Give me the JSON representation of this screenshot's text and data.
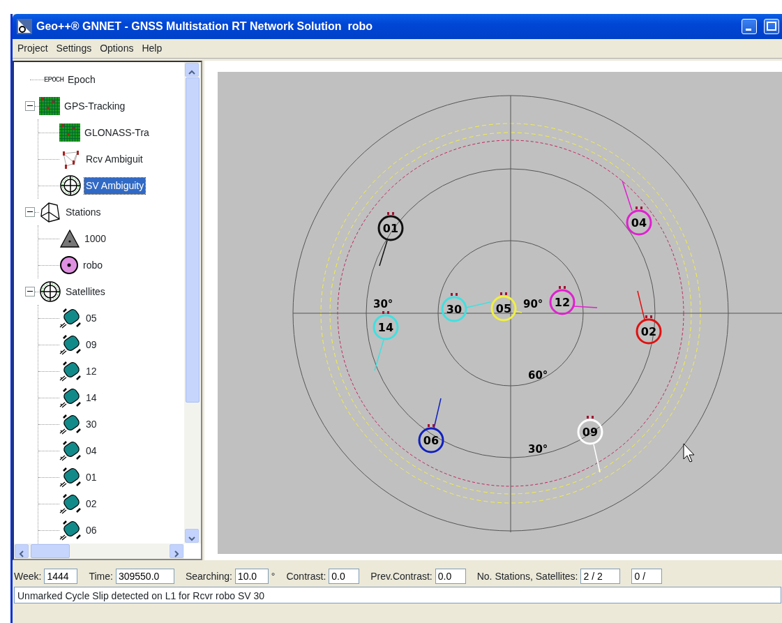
{
  "window": {
    "title": "Geo++® GNNET - GNSS Multistation RT Network Solution  robo"
  },
  "menu": [
    "Project",
    "Settings",
    "Options",
    "Help"
  ],
  "tree": [
    {
      "label": "Epoch",
      "kind": "epoch",
      "icon_text": "EPOCH",
      "selected": false
    },
    {
      "label": "GPS-Tracking",
      "kind": "grid",
      "selected": false,
      "expanded": true,
      "children": [
        {
          "label": "GLONASS-Tra",
          "kind": "grid",
          "selected": false
        },
        {
          "label": "Rcv Ambiguit",
          "kind": "network",
          "selected": false
        },
        {
          "label": "SV Ambiguity",
          "kind": "polar",
          "selected": true
        }
      ]
    },
    {
      "label": "Stations",
      "kind": "stations",
      "selected": false,
      "expanded": true,
      "children": [
        {
          "label": "1000",
          "kind": "triangle",
          "selected": false
        },
        {
          "label": "robo",
          "kind": "dot",
          "selected": false
        }
      ]
    },
    {
      "label": "Satellites",
      "kind": "polar",
      "selected": false,
      "expanded": true,
      "children": [
        {
          "label": "05",
          "kind": "satellite",
          "selected": false
        },
        {
          "label": "09",
          "kind": "satellite",
          "selected": false
        },
        {
          "label": "12",
          "kind": "satellite",
          "selected": false
        },
        {
          "label": "14",
          "kind": "satellite",
          "selected": false
        },
        {
          "label": "30",
          "kind": "satellite",
          "selected": false
        },
        {
          "label": "04",
          "kind": "satellite",
          "selected": false
        },
        {
          "label": "01",
          "kind": "satellite",
          "selected": false
        },
        {
          "label": "02",
          "kind": "satellite",
          "selected": false
        },
        {
          "label": "06",
          "kind": "satellite",
          "selected": false
        }
      ]
    }
  ],
  "skyplot": {
    "elevation_labels": [
      "30°",
      "90°",
      "60°",
      "30°"
    ],
    "satellites": [
      {
        "label": "01",
        "color": "#101010"
      },
      {
        "label": "04",
        "color": "#e020d0"
      },
      {
        "label": "30",
        "color": "#40e0e0"
      },
      {
        "label": "05",
        "color": "#f0f040"
      },
      {
        "label": "12",
        "color": "#e020d0"
      },
      {
        "label": "14",
        "color": "#40e0e0"
      },
      {
        "label": "02",
        "color": "#e01010"
      },
      {
        "label": "06",
        "color": "#1020c0"
      },
      {
        "label": "09",
        "color": "#ffffff"
      }
    ]
  },
  "status_fields": [
    {
      "label": "Week:",
      "value": "1444"
    },
    {
      "label": "Time:",
      "value": "309550.0"
    },
    {
      "label": "Searching:",
      "value": "10.0",
      "unit": "°"
    },
    {
      "label": "Contrast:",
      "value": "0.0"
    },
    {
      "label": "Prev.Contrast:",
      "value": "0.0"
    },
    {
      "label": "No. Stations, Satellites:",
      "value": "2 / 2"
    },
    {
      "value": "0 /"
    }
  ],
  "message": "Unmarked Cycle Slip detected on L1 for Rcvr robo SV 30"
}
